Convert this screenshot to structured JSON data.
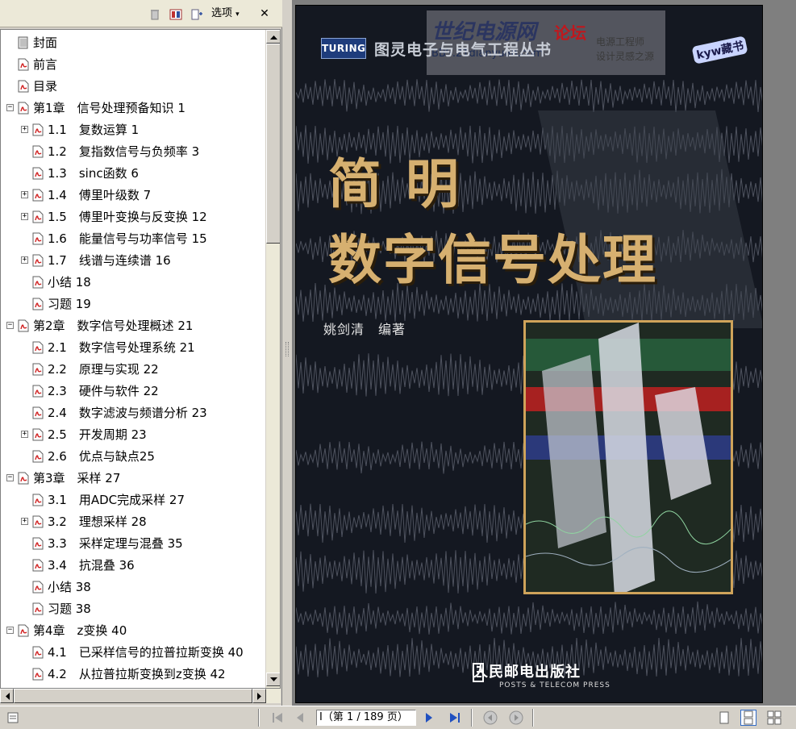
{
  "bookmarks_panel": {
    "options_label": "选项",
    "items": [
      {
        "label": "封面",
        "level": 0,
        "expander": "",
        "icon": "page"
      },
      {
        "label": "前言",
        "level": 0,
        "expander": "",
        "icon": "pdf"
      },
      {
        "label": "目录",
        "level": 0,
        "expander": "",
        "icon": "pdf"
      },
      {
        "label": "第1章　信号处理预备知识 1",
        "level": 0,
        "expander": "−",
        "icon": "pdf"
      },
      {
        "label": "1.1　复数运算 1",
        "level": 1,
        "expander": "+",
        "icon": "pdf"
      },
      {
        "label": "1.2　复指数信号与负频率 3",
        "level": 1,
        "expander": "",
        "icon": "pdf"
      },
      {
        "label": "1.3　sinc函数 6",
        "level": 1,
        "expander": "",
        "icon": "pdf"
      },
      {
        "label": "1.4　傅里叶级数 7",
        "level": 1,
        "expander": "+",
        "icon": "pdf"
      },
      {
        "label": "1.5　傅里叶变换与反变换 12",
        "level": 1,
        "expander": "+",
        "icon": "pdf"
      },
      {
        "label": "1.6　能量信号与功率信号 15",
        "level": 1,
        "expander": "",
        "icon": "pdf"
      },
      {
        "label": "1.7　线谱与连续谱 16",
        "level": 1,
        "expander": "+",
        "icon": "pdf"
      },
      {
        "label": "小结 18",
        "level": 1,
        "expander": "",
        "icon": "pdf"
      },
      {
        "label": "习题 19",
        "level": 1,
        "expander": "",
        "icon": "pdf"
      },
      {
        "label": "第2章　数字信号处理概述 21",
        "level": 0,
        "expander": "−",
        "icon": "pdf"
      },
      {
        "label": "2.1　数字信号处理系统 21",
        "level": 1,
        "expander": "",
        "icon": "pdf"
      },
      {
        "label": "2.2　原理与实现 22",
        "level": 1,
        "expander": "",
        "icon": "pdf"
      },
      {
        "label": "2.3　硬件与软件 22",
        "level": 1,
        "expander": "",
        "icon": "pdf"
      },
      {
        "label": "2.4　数字滤波与频谱分析 23",
        "level": 1,
        "expander": "",
        "icon": "pdf"
      },
      {
        "label": "2.5　开发周期 23",
        "level": 1,
        "expander": "+",
        "icon": "pdf"
      },
      {
        "label": "2.6　优点与缺点25",
        "level": 1,
        "expander": "",
        "icon": "pdf"
      },
      {
        "label": "第3章　采样 27",
        "level": 0,
        "expander": "−",
        "icon": "pdf"
      },
      {
        "label": "3.1　用ADC完成采样 27",
        "level": 1,
        "expander": "",
        "icon": "pdf"
      },
      {
        "label": "3.2　理想采样 28",
        "level": 1,
        "expander": "+",
        "icon": "pdf"
      },
      {
        "label": "3.3　采样定理与混叠 35",
        "level": 1,
        "expander": "",
        "icon": "pdf"
      },
      {
        "label": "3.4　抗混叠 36",
        "level": 1,
        "expander": "",
        "icon": "pdf"
      },
      {
        "label": "小结 38",
        "level": 1,
        "expander": "",
        "icon": "pdf"
      },
      {
        "label": "习题 38",
        "level": 1,
        "expander": "",
        "icon": "pdf"
      },
      {
        "label": "第4章　z变换 40",
        "level": 0,
        "expander": "−",
        "icon": "pdf"
      },
      {
        "label": "4.1　已采样信号的拉普拉斯变换 40",
        "level": 1,
        "expander": "",
        "icon": "pdf"
      },
      {
        "label": "4.2　从拉普拉斯变换到z变换 42",
        "level": 1,
        "expander": "",
        "icon": "pdf"
      }
    ]
  },
  "cover": {
    "turing_logo": "TURING",
    "series_title": "图灵电子与电气工程丛书",
    "watermark_site": "世纪电源网",
    "watermark_forum": "论坛",
    "watermark_bbs": "BBS.21dianyuan.com",
    "watermark_eng": "电源工程师",
    "watermark_home": "设计灵感之源",
    "badge": "kyw藏书",
    "title_line1": "简明",
    "title_line2": "数字信号处理",
    "author": "姚剑清　编著",
    "publisher": "人民邮电出版社",
    "publisher_en": "POSTS & TELECOM PRESS"
  },
  "statusbar": {
    "page_field": "I（第 1 / 189 页）"
  },
  "colors": {
    "title_gold": "#d6b070",
    "page_bg": "#141821",
    "panel_bg": "#d4d0c8"
  }
}
